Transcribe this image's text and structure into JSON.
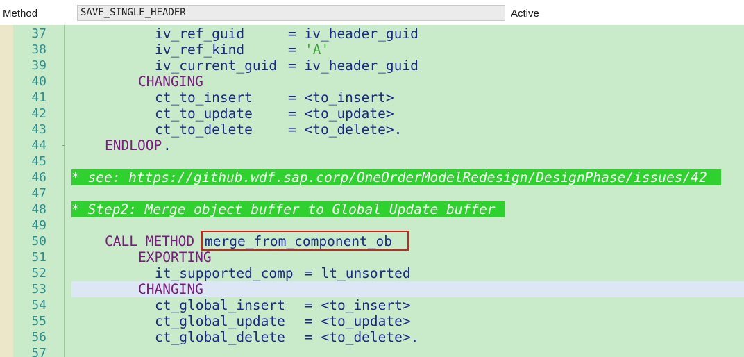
{
  "header": {
    "method_label": "Method",
    "method_name": "SAVE_SINGLE_HEADER",
    "status": "Active"
  },
  "editor": {
    "lines": [
      {
        "num": "37",
        "a": "iv_ref_guid",
        "b": "= iv_header_guid"
      },
      {
        "num": "38",
        "a": "iv_ref_kind",
        "b": "= ",
        "str": "'A'"
      },
      {
        "num": "39",
        "a": "iv_current_guid",
        "b": "= iv_header_guid"
      },
      {
        "num": "40",
        "kw": "CHANGING"
      },
      {
        "num": "41",
        "a": "ct_to_insert",
        "b": "= <to_insert>"
      },
      {
        "num": "42",
        "a": "ct_to_update",
        "b": "= <to_update>"
      },
      {
        "num": "43",
        "a": "ct_to_delete",
        "b": "= <to_delete>."
      },
      {
        "num": "44",
        "kw": "ENDLOOP",
        "tail": "."
      },
      {
        "num": "45"
      },
      {
        "num": "46",
        "comment": "* see: https://github.wdf.sap.corp/OneOrderModelRedesign/DesignPhase/issues/42"
      },
      {
        "num": "47"
      },
      {
        "num": "48",
        "comment": "* Step2: Merge object buffer to Global Update buffer"
      },
      {
        "num": "49"
      },
      {
        "num": "50",
        "kw": "CALL METHOD",
        "ident": "merge_from_component_ob"
      },
      {
        "num": "51",
        "kw": "EXPORTING"
      },
      {
        "num": "52",
        "a": "it_supported_comp",
        "b": "= lt_unsorted"
      },
      {
        "num": "53",
        "kw": "CHANGING"
      },
      {
        "num": "54",
        "a": "ct_global_insert",
        "b": "= <to_insert>"
      },
      {
        "num": "55",
        "a": "ct_global_update",
        "b": "= <to_update>"
      },
      {
        "num": "56",
        "a": "ct_global_delete",
        "b": "= <to_delete>."
      },
      {
        "num": "57"
      }
    ]
  },
  "colors": {
    "editor_bg": "#c9ebc9",
    "line_number": "#2f8f8f",
    "keyword": "#7a1c80",
    "identifier": "#1a2a88",
    "string": "#3aa33a",
    "comment_bg": "#2ed12e",
    "current_line": "#dce6f4",
    "highlight_box": "#d8201a"
  }
}
